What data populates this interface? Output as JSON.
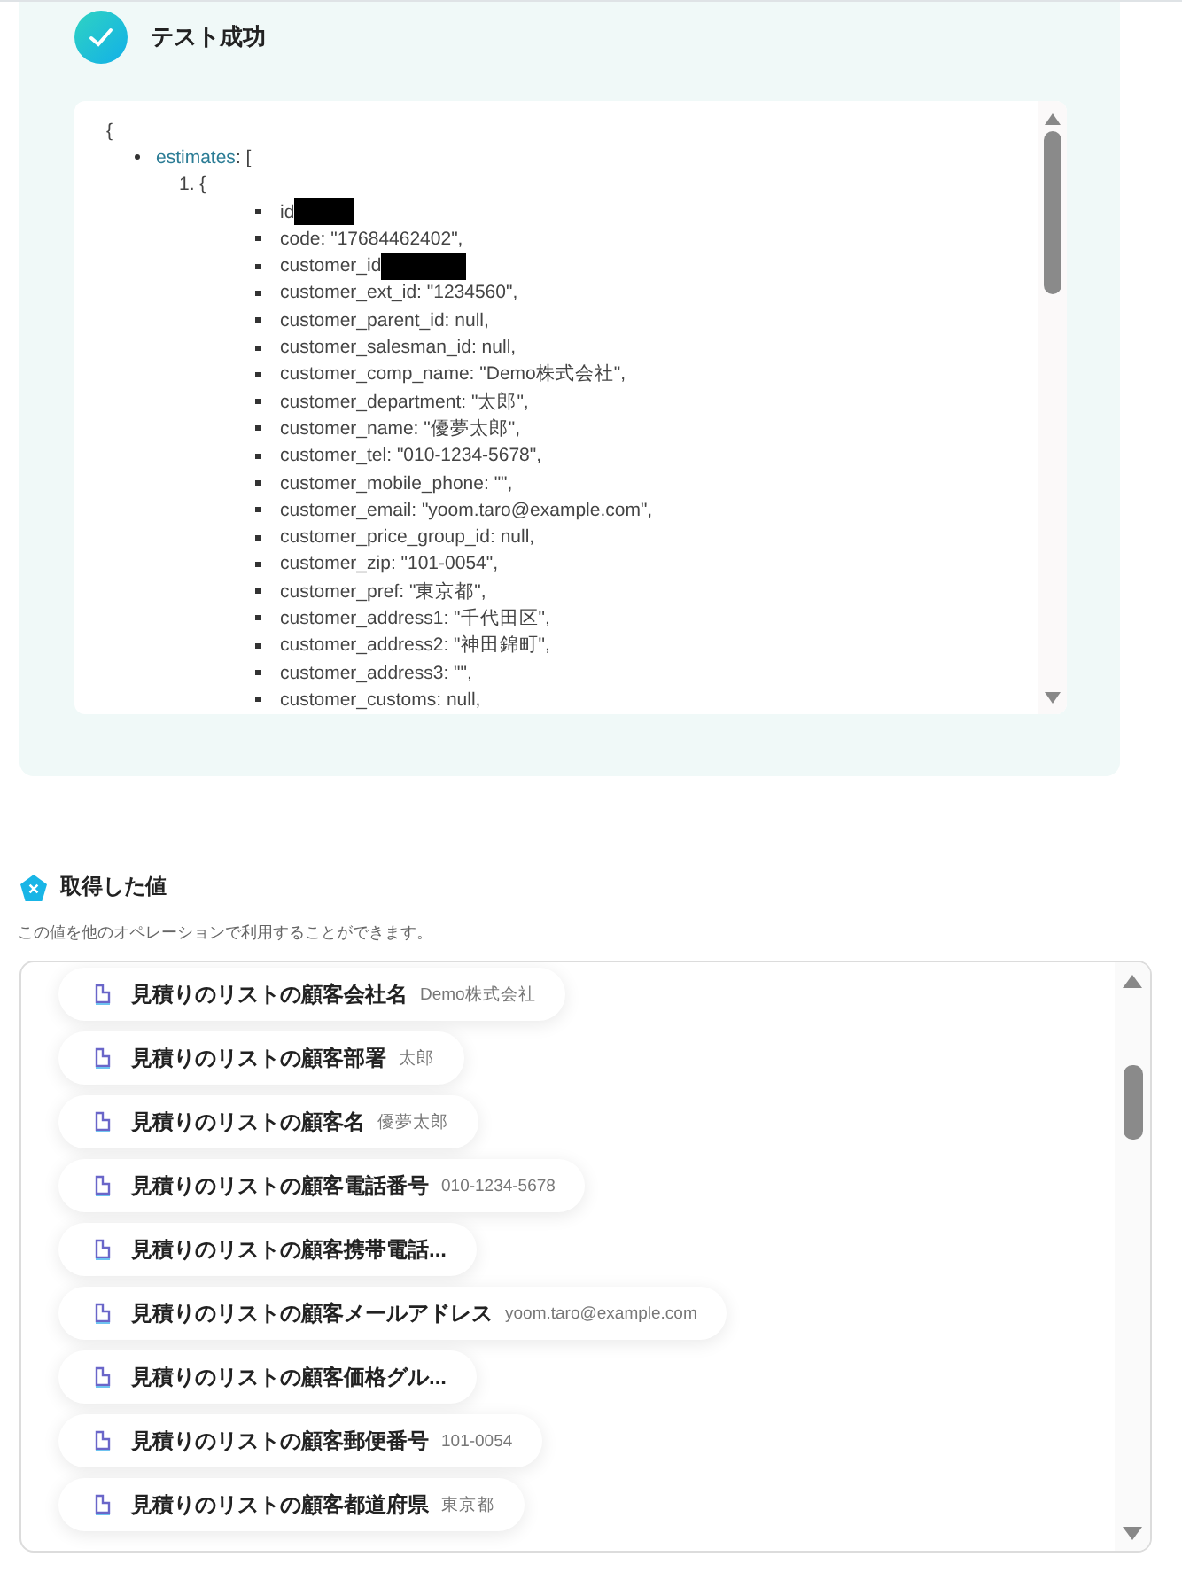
{
  "test_result": {
    "title": "テスト成功",
    "code": {
      "open": "{",
      "key": "estimates",
      "key_suffix": ": [",
      "item_index": "1. {",
      "fields": [
        {
          "text": "id",
          "redacted": true
        },
        {
          "text": "code: \"17684462402\",",
          "redacted": false
        },
        {
          "text": "customer_id",
          "redacted": true
        },
        {
          "text": "customer_ext_id: \"1234560\",",
          "redacted": false
        },
        {
          "text": "customer_parent_id: null,",
          "redacted": false
        },
        {
          "text": "customer_salesman_id: null,",
          "redacted": false
        },
        {
          "text": "customer_comp_name: \"Demo株式会社\",",
          "redacted": false
        },
        {
          "text": "customer_department: \"太郎\",",
          "redacted": false
        },
        {
          "text": "customer_name: \"優夢太郎\",",
          "redacted": false
        },
        {
          "text": "customer_tel: \"010-1234-5678\",",
          "redacted": false
        },
        {
          "text": "customer_mobile_phone: \"\",",
          "redacted": false
        },
        {
          "text": "customer_email: \"yoom.taro@example.com\",",
          "redacted": false
        },
        {
          "text": "customer_price_group_id: null,",
          "redacted": false
        },
        {
          "text": "customer_zip: \"101-0054\",",
          "redacted": false
        },
        {
          "text": "customer_pref: \"東京都\",",
          "redacted": false
        },
        {
          "text": "customer_address1: \"千代田区\",",
          "redacted": false
        },
        {
          "text": "customer_address2: \"神田錦町\",",
          "redacted": false
        },
        {
          "text": "customer_address3: \"\",",
          "redacted": false
        },
        {
          "text": "customer_customs: null,",
          "redacted": false
        }
      ]
    }
  },
  "values": {
    "title": "取得した値",
    "description": "この値を他のオペレーションで利用することができます。",
    "items": [
      {
        "label": "見積りのリストの顧客会社名",
        "value": "Demo株式会社"
      },
      {
        "label": "見積りのリストの顧客部署",
        "value": "太郎"
      },
      {
        "label": "見積りのリストの顧客名",
        "value": "優夢太郎"
      },
      {
        "label": "見積りのリストの顧客電話番号",
        "value": "010-1234-5678"
      },
      {
        "label": "見積りのリストの顧客携帯電話..."
      },
      {
        "label": "見積りのリストの顧客メールアドレス",
        "value": "yoom.taro@example.com"
      },
      {
        "label": "見積りのリストの顧客価格グル..."
      },
      {
        "label": "見積りのリストの顧客郵便番号",
        "value": "101-0054"
      },
      {
        "label": "見積りのリストの顧客都道府県",
        "value": "東京都"
      }
    ]
  }
}
